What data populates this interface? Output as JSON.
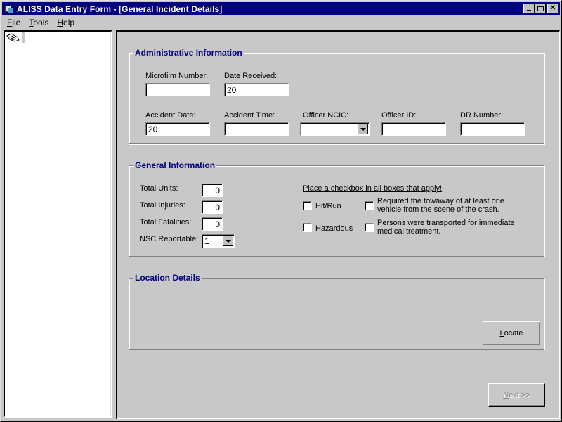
{
  "window": {
    "title": "ALISS Data Entry Form - [General Incident Details]",
    "controls": [
      "minimize",
      "maximize",
      "close"
    ]
  },
  "menu": {
    "items": [
      {
        "label": "File",
        "accel": "F",
        "rest": "ile"
      },
      {
        "label": "Tools",
        "accel": "T",
        "rest": "ools"
      },
      {
        "label": "Help",
        "accel": "H",
        "rest": "elp"
      }
    ]
  },
  "tree": {
    "icon": "hand-pointer-icon"
  },
  "admin": {
    "title": "Administrative Information",
    "microfilm_label": "Microfilm Number:",
    "microfilm_value": "",
    "date_received_label": "Date Received:",
    "date_received_value": "20",
    "accident_date_label": "Accident Date:",
    "accident_date_value": "20",
    "accident_time_label": "Accident Time:",
    "accident_time_value": "",
    "officer_ncic_label": "Officer NCIC:",
    "officer_ncic_value": "",
    "officer_id_label": "Officer ID:",
    "officer_id_value": "",
    "dr_number_label": "DR Number:",
    "dr_number_value": ""
  },
  "general": {
    "title": "General Information",
    "total_units_label": "Total Units:",
    "total_units_value": "0",
    "total_injuries_label": "Total Injuries:",
    "total_injuries_value": "0",
    "total_fatalities_label": "Total Fatalities:",
    "total_fatalities_value": "0",
    "nsc_label": "NSC Reportable:",
    "nsc_value": "1",
    "instruction": "Place a checkbox in all boxes that apply!",
    "checkboxes": {
      "hit_run": {
        "label": "Hit/Run",
        "checked": false
      },
      "hazardous": {
        "label": "Hazardous",
        "checked": false
      },
      "towaway": {
        "label_line1": "Required the towaway of at least one",
        "label_line2": "vehicle from the scene of the crash.",
        "checked": false
      },
      "transported": {
        "label_line1": "Persons were transported for immediate",
        "label_line2": "medical treatment.",
        "checked": false
      }
    }
  },
  "location": {
    "title": "Location Details",
    "locate_accel": "L",
    "locate_rest": "ocate"
  },
  "footer": {
    "next_accel": "N",
    "next_rest": "ext >>",
    "next_enabled": false
  }
}
